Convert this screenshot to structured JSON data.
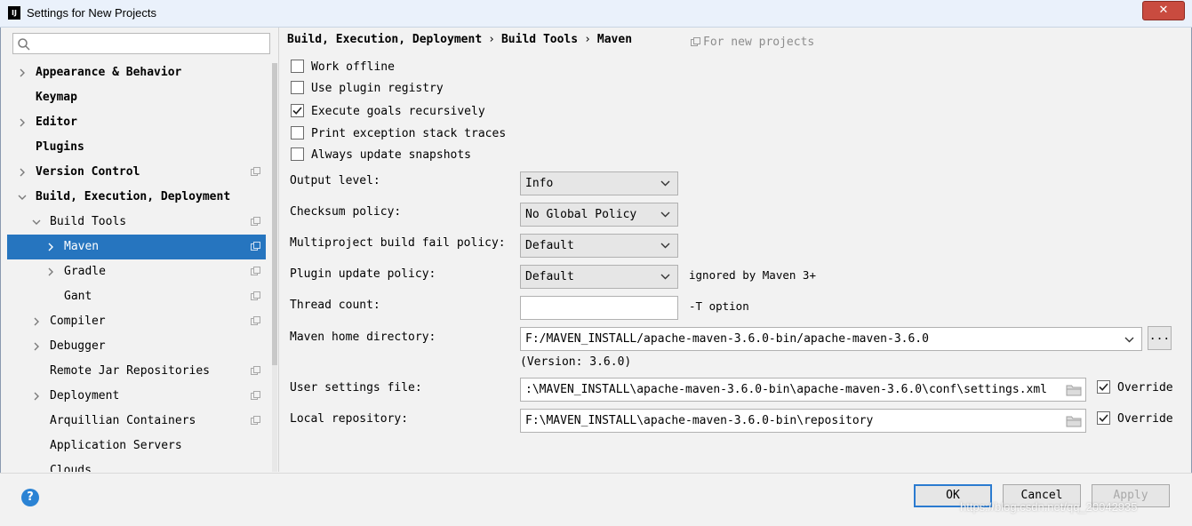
{
  "window": {
    "title": "Settings for New Projects",
    "app_icon_text": "IJ",
    "close_glyph": "✕"
  },
  "sidebar": {
    "search": {
      "value": "",
      "placeholder": ""
    },
    "items": [
      {
        "label": "Appearance & Behavior",
        "bold": true,
        "expand": "collapsed",
        "level": 0
      },
      {
        "label": "Keymap",
        "bold": true,
        "expand": "none",
        "level": 0
      },
      {
        "label": "Editor",
        "bold": true,
        "expand": "collapsed",
        "level": 0
      },
      {
        "label": "Plugins",
        "bold": true,
        "expand": "none",
        "level": 0
      },
      {
        "label": "Version Control",
        "bold": true,
        "expand": "collapsed",
        "level": 0,
        "project_icon": true
      },
      {
        "label": "Build, Execution, Deployment",
        "bold": true,
        "expand": "expanded",
        "level": 0
      },
      {
        "label": "Build Tools",
        "bold": false,
        "expand": "expanded",
        "level": 1,
        "project_icon": true
      },
      {
        "label": "Maven",
        "bold": false,
        "expand": "collapsed",
        "level": 2,
        "project_icon": true,
        "selected": true
      },
      {
        "label": "Gradle",
        "bold": false,
        "expand": "collapsed",
        "level": 2,
        "project_icon": true
      },
      {
        "label": "Gant",
        "bold": false,
        "expand": "none",
        "level": 2,
        "project_icon": true
      },
      {
        "label": "Compiler",
        "bold": false,
        "expand": "collapsed",
        "level": 1,
        "project_icon": true
      },
      {
        "label": "Debugger",
        "bold": false,
        "expand": "collapsed",
        "level": 1
      },
      {
        "label": "Remote Jar Repositories",
        "bold": false,
        "expand": "none",
        "level": 1,
        "project_icon": true
      },
      {
        "label": "Deployment",
        "bold": false,
        "expand": "collapsed",
        "level": 1,
        "project_icon": true
      },
      {
        "label": "Arquillian Containers",
        "bold": false,
        "expand": "none",
        "level": 1,
        "project_icon": true
      },
      {
        "label": "Application Servers",
        "bold": false,
        "expand": "none",
        "level": 1
      },
      {
        "label": "Clouds",
        "bold": false,
        "expand": "none",
        "level": 1
      }
    ]
  },
  "main": {
    "breadcrumb": [
      "Build, Execution, Deployment",
      "Build Tools",
      "Maven"
    ],
    "breadcrumb_sep": "›",
    "for_new_projects": "For new projects",
    "checkboxes": [
      {
        "label": "Work offline",
        "checked": false
      },
      {
        "label": "Use plugin registry",
        "checked": false
      },
      {
        "label": "Execute goals recursively",
        "checked": true
      },
      {
        "label": "Print exception stack traces",
        "checked": false
      },
      {
        "label": "Always update snapshots",
        "checked": false
      }
    ],
    "output_level": {
      "label": "Output level:",
      "value": "Info"
    },
    "checksum_policy": {
      "label": "Checksum policy:",
      "value": "No Global Policy"
    },
    "fail_policy": {
      "label": "Multiproject build fail policy:",
      "value": "Default"
    },
    "plugin_update_policy": {
      "label": "Plugin update policy:",
      "value": "Default",
      "hint": "ignored by Maven 3+"
    },
    "thread_count": {
      "label": "Thread count:",
      "value": "",
      "hint": "-T option"
    },
    "maven_home": {
      "label": "Maven home directory:",
      "value": "F:/MAVEN_INSTALL/apache-maven-3.6.0-bin/apache-maven-3.6.0",
      "version": "(Version: 3.6.0)",
      "browse_label": "..."
    },
    "user_settings": {
      "label": "User settings file:",
      "value": ":\\MAVEN_INSTALL\\apache-maven-3.6.0-bin\\apache-maven-3.6.0\\conf\\settings.xml",
      "override_label": "Override",
      "override_checked": true
    },
    "local_repo": {
      "label": "Local repository:",
      "value": "F:\\MAVEN_INSTALL\\apache-maven-3.6.0-bin\\repository",
      "override_label": "Override",
      "override_checked": true
    }
  },
  "footer": {
    "help_glyph": "?",
    "ok_label": "OK",
    "cancel_label": "Cancel",
    "apply_label": "Apply",
    "watermark": "https://blog.csdn.net/qq_20042935"
  },
  "colors": {
    "selection": "#2675bf",
    "accent": "#2b7bd0",
    "help": "#2b83d4",
    "close": "#c94b3f"
  }
}
